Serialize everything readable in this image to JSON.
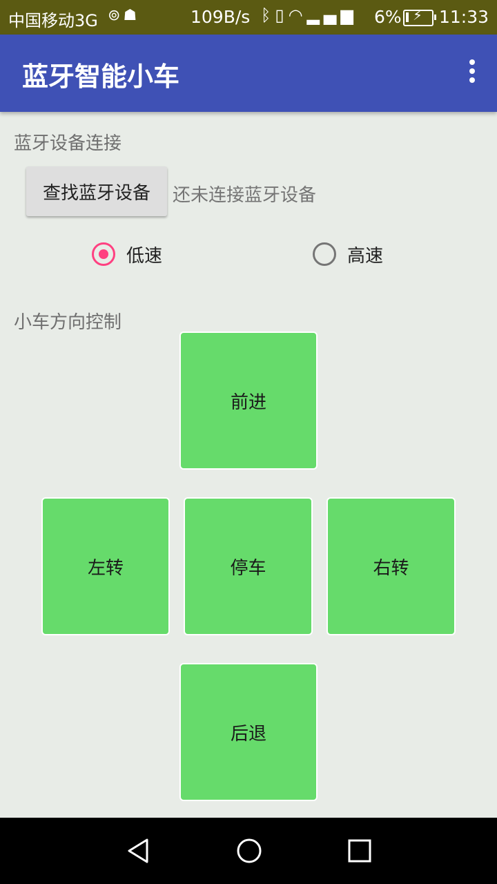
{
  "status_bar": {
    "carrier": "中国移动3G",
    "net_speed": "109B/s",
    "battery_percent": "6%",
    "time": "11:33",
    "icons_left": [
      "location-icon",
      "android-debug-icon"
    ],
    "icons_right": [
      "bluetooth-icon",
      "vibrate-icon",
      "wifi-icon",
      "signal-3g-icon"
    ]
  },
  "app_bar": {
    "title": "蓝牙智能小车",
    "menu_icon": "overflow-menu-icon"
  },
  "bluetooth_section": {
    "label": "蓝牙设备连接",
    "find_button": "查找蓝牙设备",
    "connection_status": "还未连接蓝牙设备"
  },
  "speed_options": [
    {
      "label": "低速",
      "checked": true
    },
    {
      "label": "高速",
      "checked": false
    }
  ],
  "direction_section": {
    "label": "小车方向控制",
    "forward": "前进",
    "left": "左转",
    "stop": "停车",
    "right": "右转",
    "backward": "后退"
  },
  "colors": {
    "app_bar": "#3f51b5",
    "accent": "#ff4081",
    "control_button": "#66db6b",
    "background": "#e8ece7"
  },
  "nav_bar": [
    "back-icon",
    "home-icon",
    "recents-icon"
  ]
}
